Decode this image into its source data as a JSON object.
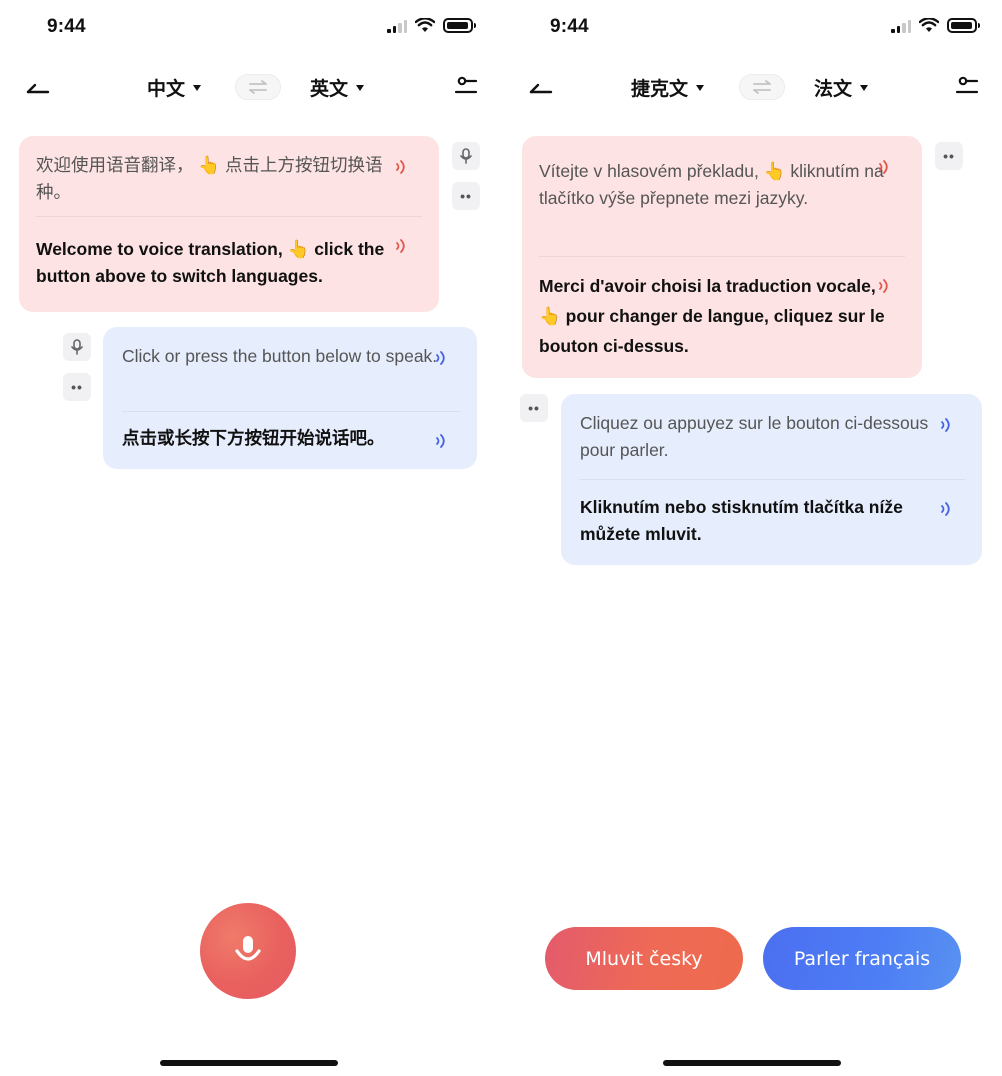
{
  "left": {
    "status": {
      "time": "9:44"
    },
    "nav": {
      "source_lang": "中文",
      "target_lang": "英文"
    },
    "bubble1": {
      "original": "欢迎使用语音翻译， 👆 点击上方按钮切换语种。",
      "translation": "Welcome to  voice translation, 👆 click the button above to switch languages."
    },
    "bubble2": {
      "original": "Click or press the button below to speak.",
      "translation": "点击或长按下方按钮开始说话吧。"
    }
  },
  "right": {
    "status": {
      "time": "9:44"
    },
    "nav": {
      "source_lang": "捷克文",
      "target_lang": "法文"
    },
    "bubble1": {
      "original": "Vítejte v hlasovém překladu, 👆 kliknutím na tlačítko výše přepnete mezi jazyky.",
      "translation": "Merci d'avoir choisi la traduction vocale, 👆 pour changer de langue, cliquez sur le bouton ci-dessus."
    },
    "bubble2": {
      "original": "Cliquez ou appuyez sur le bouton ci-dessous pour parler.",
      "translation": "Kliknutím nebo stisknutím tlačítka níže můžete mluvit."
    },
    "buttons": {
      "speak_source": "Mluvit česky",
      "speak_target": "Parler français"
    }
  },
  "colors": {
    "pink_bubble": "#fde3e3",
    "blue_bubble": "#e6edfc",
    "speaker_red": "#e2574c",
    "speaker_blue": "#4561e6",
    "mic_button": "#e9605e"
  },
  "icons": {
    "back": "back-arrow-icon",
    "swap": "swap-arrows-icon",
    "settings": "settings-sliders-icon",
    "speaker": "speaker-icon",
    "mic": "microphone-icon",
    "more": "more-dots-icon"
  }
}
